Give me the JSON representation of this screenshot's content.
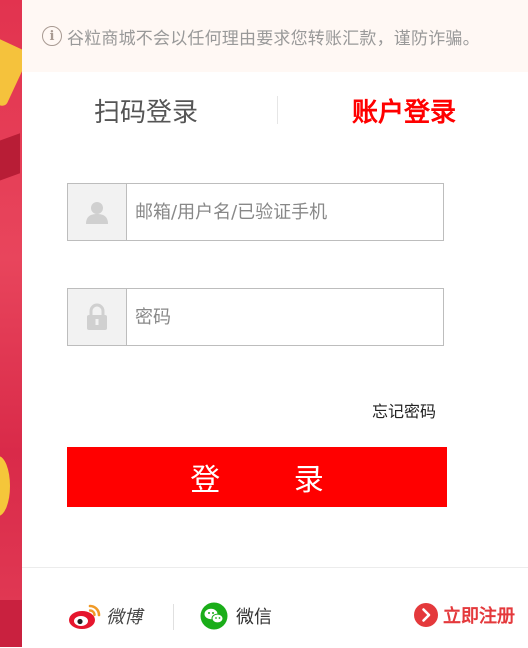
{
  "notice": {
    "icon": "info-icon",
    "icon_glyph": "i",
    "text": "谷粒商城不会以任何理由要求您转账汇款，谨防诈骗。"
  },
  "tabs": {
    "qr_login": "扫码登录",
    "account_login": "账户登录",
    "active": "account_login",
    "active_color": "#ff0000"
  },
  "form": {
    "username": {
      "icon": "user-icon",
      "placeholder": "邮箱/用户名/已验证手机",
      "value": ""
    },
    "password": {
      "icon": "lock-icon",
      "placeholder": "密码",
      "value": ""
    },
    "forgot_password": "忘记密码",
    "submit_label": "登 录",
    "submit_color": "#ff0000"
  },
  "footer": {
    "weibo": {
      "icon": "weibo-icon",
      "label": "微博"
    },
    "wechat": {
      "icon": "wechat-icon",
      "label": "微信"
    },
    "register": {
      "icon": "arrow-circle-icon",
      "label": "立即注册",
      "color": "#e4393c"
    }
  }
}
